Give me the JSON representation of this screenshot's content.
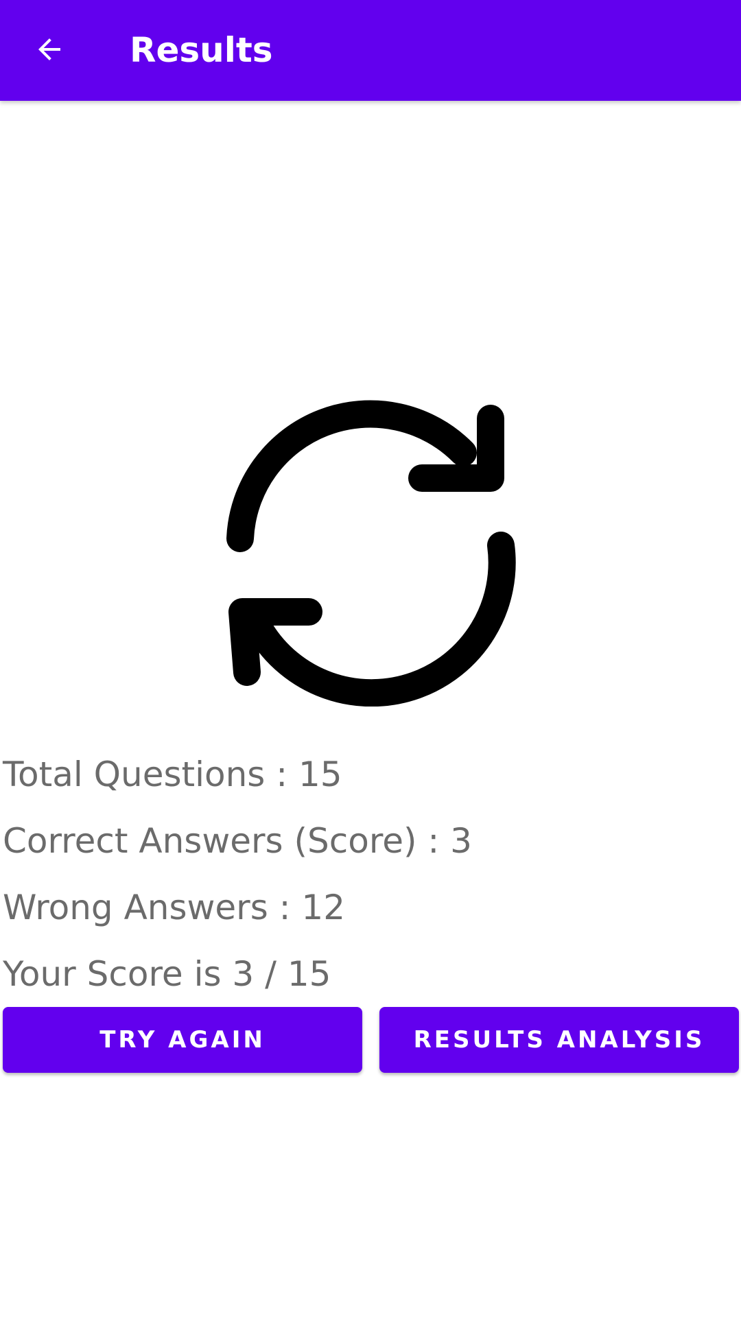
{
  "app_bar": {
    "title": "Results",
    "back_icon": "arrow-back-icon",
    "color": "#6200EE"
  },
  "result_icon": "sync-icon",
  "stats": {
    "total_questions": "Total Questions : 15",
    "correct_answers": "Correct Answers (Score) : 3",
    "wrong_answers": "Wrong Answers : 12",
    "your_score": "Your Score is 3 / 15"
  },
  "buttons": {
    "try_again": "TRY AGAIN",
    "results_analysis": "RESULTS ANALYSIS"
  }
}
